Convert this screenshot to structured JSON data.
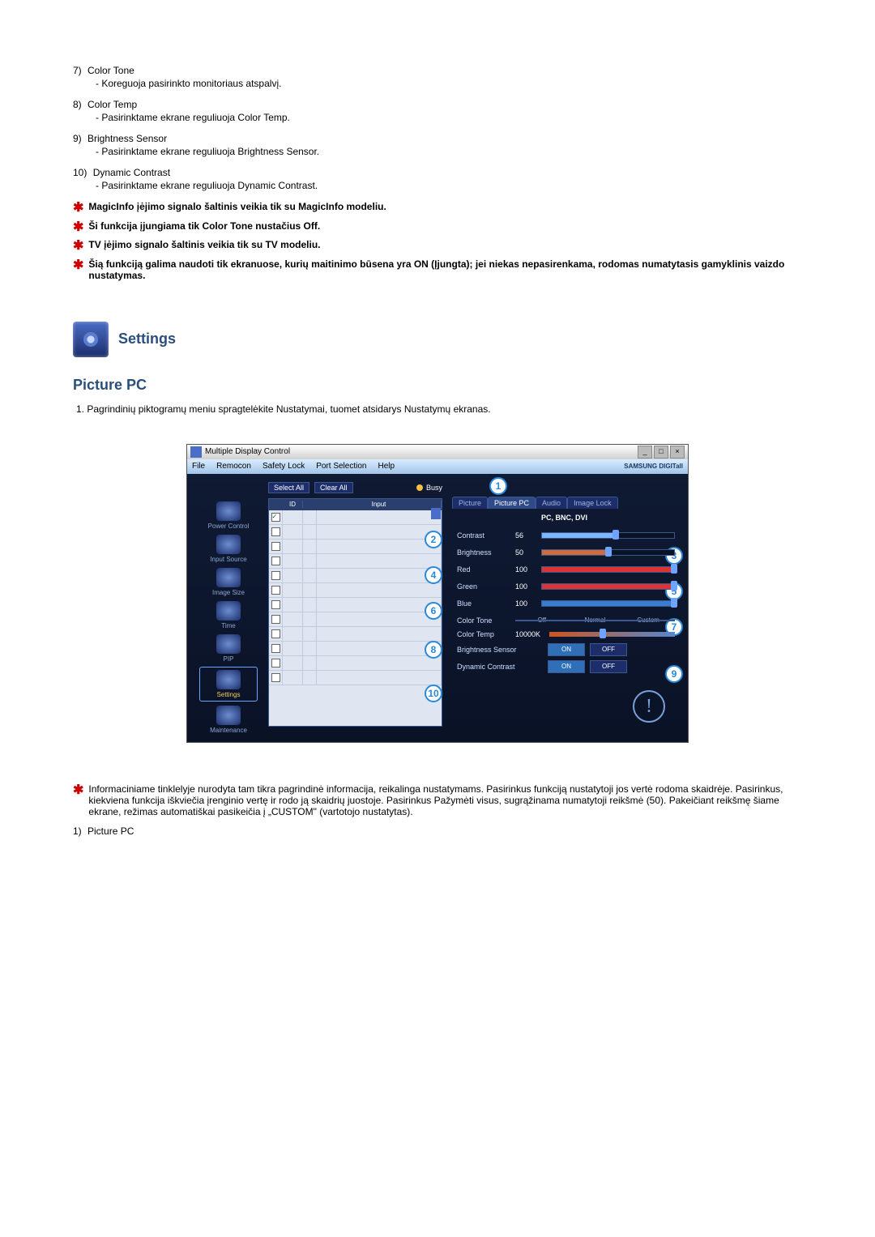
{
  "items": [
    {
      "num": "7)",
      "title": "Color Tone",
      "desc": "- Koreguoja pasirinkto monitoriaus atspalvį."
    },
    {
      "num": "8)",
      "title": "Color Temp",
      "desc": "- Pasirinktame ekrane reguliuoja Color Temp."
    },
    {
      "num": "9)",
      "title": "Brightness Sensor",
      "desc": "- Pasirinktame ekrane reguliuoja Brightness Sensor."
    },
    {
      "num": "10)",
      "title": "Dynamic Contrast",
      "desc": "- Pasirinktame ekrane reguliuoja Dynamic Contrast."
    }
  ],
  "stars": [
    "MagicInfo įėjimo signalo šaltinis veikia tik su MagicInfo modeliu.",
    "Ši funkcija įjungiama tik Color Tone nustačius Off.",
    "TV įėjimo signalo šaltinis veikia tik su TV modeliu.",
    "Šią funkciją galima naudoti tik ekranuose, kurių maitinimo būsena yra ON (Įjungta); jei niekas nepasirenkama, rodomas numatytasis gamyklinis vaizdo nustatymas."
  ],
  "settings_title": "Settings",
  "section": {
    "title": "Picture PC",
    "desc_num": "1.",
    "desc": "Pagrindinių piktogramų meniu spragtelėkite Nustatymai, tuomet atsidarys Nustatymų ekranas."
  },
  "app": {
    "title": "Multiple Display Control",
    "menu": [
      "File",
      "Remocon",
      "Safety Lock",
      "Port Selection",
      "Help"
    ],
    "brand": "SAMSUNG DIGITall",
    "sidebar": [
      "Power Control",
      "Input Source",
      "Image Size",
      "Time",
      "PIP",
      "Settings",
      "Maintenance"
    ],
    "toolbar": {
      "select_all": "Select All",
      "clear_all": "Clear All",
      "busy": "Busy"
    },
    "grid_head": [
      "",
      "ID",
      "",
      "Input"
    ],
    "tabs": [
      "Picture",
      "Picture PC",
      "Audio",
      "Image Lock"
    ],
    "subheader": "PC, BNC, DVI",
    "sliders": [
      {
        "label": "Contrast",
        "value": "56",
        "pct": 56,
        "fill": "#7ab8ff"
      },
      {
        "label": "Brightness",
        "value": "50",
        "pct": 50,
        "fill": "#d06b3a"
      },
      {
        "label": "Red",
        "value": "100",
        "pct": 100,
        "fill": "#d33"
      },
      {
        "label": "Green",
        "value": "100",
        "pct": 100,
        "fill": "#d33"
      },
      {
        "label": "Blue",
        "value": "100",
        "pct": 100,
        "fill": "#3a7dd0"
      }
    ],
    "color_tone": {
      "label": "Color Tone",
      "opts": [
        "Off",
        "Normal",
        "Custom"
      ]
    },
    "color_temp": {
      "label": "Color Temp",
      "value": "10000K"
    },
    "toggles": [
      {
        "label": "Brightness Sensor",
        "on": "ON",
        "off": "OFF"
      },
      {
        "label": "Dynamic Contrast",
        "on": "ON",
        "off": "OFF"
      }
    ],
    "circles": [
      "1",
      "2",
      "3",
      "4",
      "5",
      "6",
      "7",
      "8",
      "9",
      "10"
    ]
  },
  "bottom_star": "Informaciniame tinklelyje nurodyta tam tikra pagrindinė informacija, reikalinga nustatymams. Pasirinkus funkciją nustatytoji jos vertė rodoma skaidrėje. Pasirinkus, kiekviena funkcija iškviečia įrenginio vertę ir rodo ją skaidrių juostoje. Pasirinkus Pažymėti visus, sugrąžinama numatytoji reikšmė (50). Pakeičiant reikšmę šiame ekrane, režimas automatiškai pasikeičia į „CUSTOM\" (vartotojo nustatytas).",
  "bottom_item": {
    "num": "1)",
    "title": "Picture PC"
  }
}
